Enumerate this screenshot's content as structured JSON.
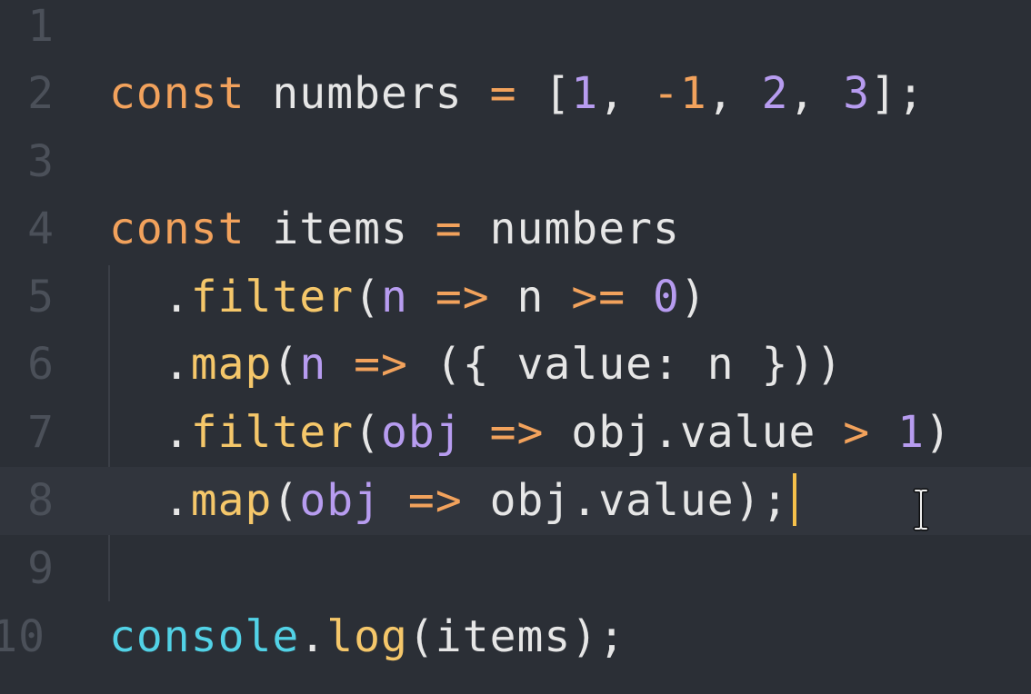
{
  "editor": {
    "colors": {
      "background": "#2b2f36",
      "line_number": "#4b5059",
      "keyword": "#f2a25c",
      "function": "#f5c76a",
      "number": "#b79cf0",
      "object": "#52d2e6",
      "cursor": "#f5c04a"
    },
    "line_numbers": [
      "1",
      "2",
      "3",
      "4",
      "5",
      "6",
      "7",
      "8",
      "9",
      "10"
    ],
    "lines": [
      {
        "tokens": []
      },
      {
        "tokens": [
          "const",
          " numbers ",
          "=",
          " [",
          "1",
          ", ",
          "-1",
          ", ",
          "2",
          ", ",
          "3",
          "];"
        ]
      },
      {
        "tokens": []
      },
      {
        "tokens": [
          "const",
          " items ",
          "=",
          " numbers"
        ]
      },
      {
        "tokens": [
          "  .",
          "filter",
          "(",
          "n",
          " ",
          "=>",
          " n ",
          ">=",
          " ",
          "0",
          ")"
        ]
      },
      {
        "tokens": [
          "  .",
          "map",
          "(",
          "n",
          " ",
          "=>",
          " ({ value: n }))"
        ]
      },
      {
        "tokens": [
          "  .",
          "filter",
          "(",
          "obj",
          " ",
          "=>",
          " obj.value ",
          ">",
          " ",
          "1",
          ")"
        ]
      },
      {
        "tokens": [
          "  .",
          "map",
          "(",
          "obj",
          " ",
          "=>",
          " obj.value);"
        ]
      },
      {
        "tokens": []
      },
      {
        "tokens": [
          "console",
          ".",
          "log",
          "(items);"
        ]
      }
    ],
    "cursor_line": "8",
    "mouse_pointer": "ibeam-icon"
  }
}
